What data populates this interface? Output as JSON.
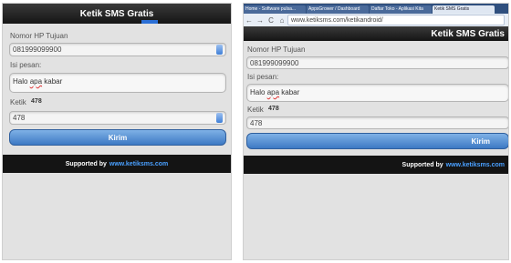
{
  "app": {
    "title": "Ketik SMS Gratis"
  },
  "form": {
    "phone_label": "Nomor HP Tujuan",
    "phone_value": "081999099900",
    "message_label": "Isi pesan:",
    "message_prefix": "Halo ",
    "message_misspelled": "apa",
    "message_suffix": " kabar",
    "captcha_label": "Ketik",
    "captcha_code": "478",
    "captcha_value": "478",
    "submit_label": "Kirim"
  },
  "footer": {
    "text": "Supported by",
    "link": "www.ketiksms.com"
  },
  "browser": {
    "tabs": [
      {
        "label": "Home - Software pulsa...",
        "active": false
      },
      {
        "label": "AppsGrower / Dashboard",
        "active": false
      },
      {
        "label": "Daftar Toko - Aplikasi Kita",
        "active": false
      },
      {
        "label": "Ketik SMS Gratis",
        "active": true
      }
    ],
    "back": "←",
    "forward": "→",
    "reload": "C",
    "home": "⌂",
    "url": "www.ketiksms.com/ketikandroid/"
  },
  "right_footer": {
    "text": "Supported by",
    "link": "www.ketiksms.com"
  },
  "colors": {
    "accent": "#2b6fd6",
    "button": "#5a90d2",
    "footer_bg": "#141414",
    "page_bg": "#e2e2e2"
  }
}
